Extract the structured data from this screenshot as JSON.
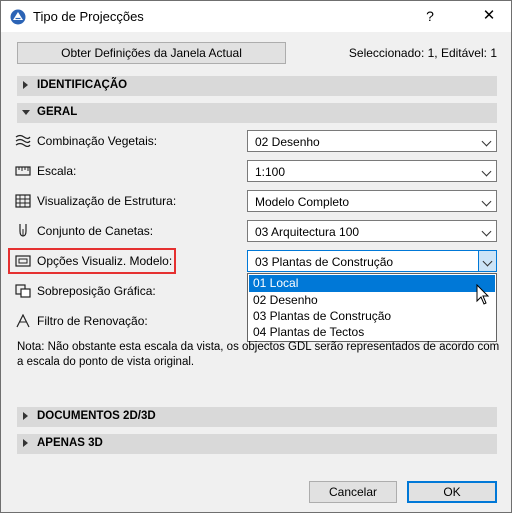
{
  "window": {
    "title": "Tipo de Projecções",
    "help_label": "?",
    "close_label": "✕"
  },
  "toolbar": {
    "get_settings_label": "Obter Definições da Janela Actual",
    "selection_status": "Seleccionado: 1, Editável: 1"
  },
  "sections": {
    "identificacao": "IDENTIFICAÇÃO",
    "geral": "GERAL",
    "documentos": "DOCUMENTOS 2D/3D",
    "apenas3d": "APENAS 3D"
  },
  "geral": {
    "combinacao": {
      "label": "Combinação Vegetais:",
      "value": "02 Desenho"
    },
    "escala": {
      "label": "Escala:",
      "value": "1:100"
    },
    "visualizacao": {
      "label": "Visualização de Estrutura:",
      "value": "Modelo Completo"
    },
    "canetas": {
      "label": "Conjunto de Canetas:",
      "value": "03 Arquitectura 100"
    },
    "opcoes": {
      "label": "Opções Visualiz. Modelo:",
      "value": "03 Plantas de Construção"
    },
    "sobreposicao": {
      "label": "Sobreposição Gráfica:"
    },
    "filtro": {
      "label": "Filtro de Renovação:"
    }
  },
  "dropdown": {
    "options": [
      "01 Local",
      "02 Desenho",
      "03 Plantas de Construção",
      "04 Plantas de Tectos"
    ],
    "highlighted": "01 Local"
  },
  "note": "Nota: Não obstante esta escala da vista, os objectos GDL serão representados de acordo com a escala do ponto de vista original.",
  "footer": {
    "cancel_label": "Cancelar",
    "ok_label": "OK"
  },
  "colors": {
    "accent": "#0078d7",
    "highlight_box": "#e53030",
    "section_bg": "#d9d9d9"
  }
}
